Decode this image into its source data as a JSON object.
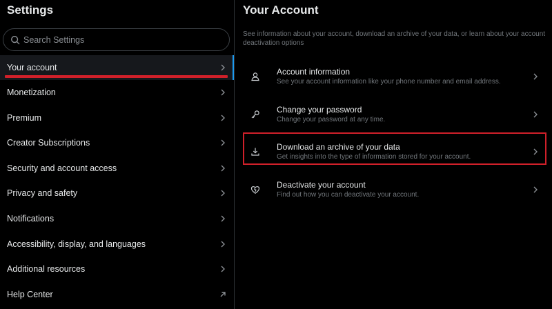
{
  "left": {
    "title": "Settings",
    "search_placeholder": "Search Settings",
    "items": [
      {
        "label": "Your account",
        "icon": "chevron-right-icon"
      },
      {
        "label": "Monetization",
        "icon": "chevron-right-icon"
      },
      {
        "label": "Premium",
        "icon": "chevron-right-icon"
      },
      {
        "label": "Creator Subscriptions",
        "icon": "chevron-right-icon"
      },
      {
        "label": "Security and account access",
        "icon": "chevron-right-icon"
      },
      {
        "label": "Privacy and safety",
        "icon": "chevron-right-icon"
      },
      {
        "label": "Notifications",
        "icon": "chevron-right-icon"
      },
      {
        "label": "Accessibility, display, and languages",
        "icon": "chevron-right-icon"
      },
      {
        "label": "Additional resources",
        "icon": "chevron-right-icon"
      },
      {
        "label": "Help Center",
        "icon": "external-link-arrow-icon"
      }
    ]
  },
  "right": {
    "title": "Your Account",
    "description": "See information about your account, download an archive of your data, or learn about your account deactivation options",
    "options": [
      {
        "title": "Account information",
        "subtitle": "See your account information like your phone number and email address.",
        "icon": "person-icon"
      },
      {
        "title": "Change your password",
        "subtitle": "Change your password at any time.",
        "icon": "key-icon"
      },
      {
        "title": "Download an archive of your data",
        "subtitle": "Get insights into the type of information stored for your account.",
        "icon": "download-icon"
      },
      {
        "title": "Deactivate your account",
        "subtitle": "Find out how you can deactivate your account.",
        "icon": "broken-heart-icon"
      }
    ]
  },
  "colors": {
    "background": "#000000",
    "text_primary": "#e7e9ea",
    "text_secondary": "#71767b",
    "accent": "#1d9bf0",
    "highlight_red": "#d0202a"
  }
}
